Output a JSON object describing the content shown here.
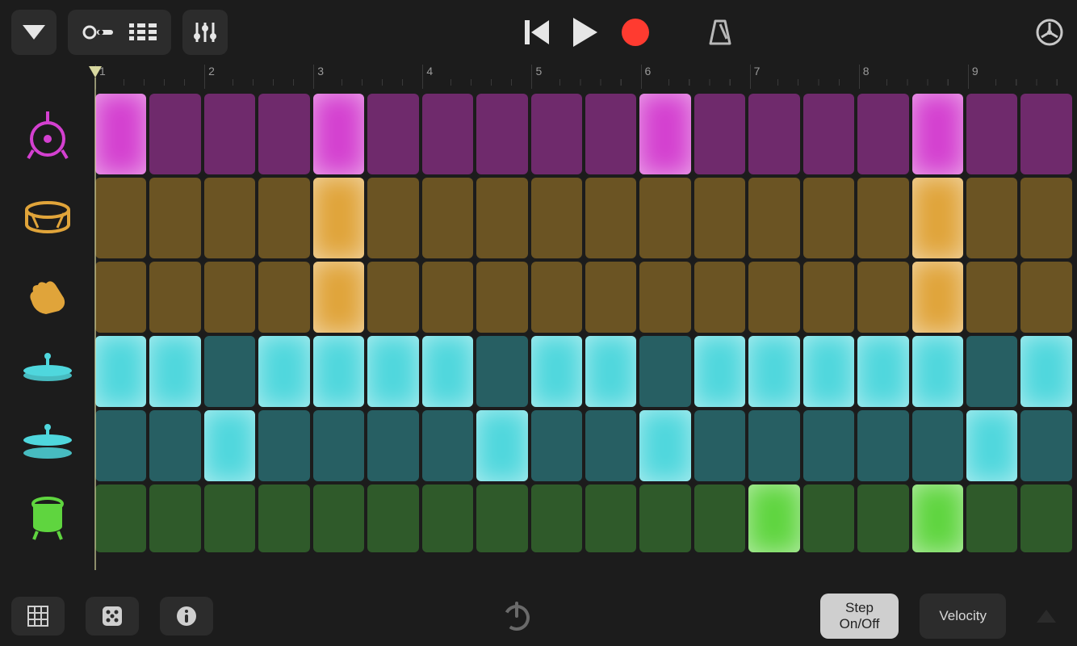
{
  "ruler": {
    "bars": [
      1,
      2,
      3,
      4,
      5,
      6,
      7,
      8,
      9
    ]
  },
  "rows": [
    {
      "id": "kick",
      "color_off": "#6f2a6c",
      "color_on": "#d440d0",
      "pattern": [
        1,
        0,
        0,
        0,
        1,
        0,
        0,
        0,
        0,
        0,
        1,
        0,
        0,
        0,
        0,
        1,
        0,
        0
      ]
    },
    {
      "id": "snare",
      "color_off": "#6b5423",
      "color_on": "#e0a43a",
      "pattern": [
        0,
        0,
        0,
        0,
        1,
        0,
        0,
        0,
        0,
        0,
        0,
        0,
        0,
        0,
        0,
        1,
        0,
        0
      ]
    },
    {
      "id": "clap",
      "color_off": "#6b5423",
      "color_on": "#e0a43a",
      "pattern": [
        0,
        0,
        0,
        0,
        1,
        0,
        0,
        0,
        0,
        0,
        0,
        0,
        0,
        0,
        0,
        1,
        0,
        0
      ]
    },
    {
      "id": "closed-hat",
      "color_off": "#275f63",
      "color_on": "#4fd7dd",
      "pattern": [
        1,
        1,
        0,
        1,
        1,
        1,
        1,
        0,
        1,
        1,
        0,
        1,
        1,
        1,
        1,
        1,
        0,
        1
      ]
    },
    {
      "id": "open-hat",
      "color_off": "#275f63",
      "color_on": "#4fd7dd",
      "pattern": [
        0,
        0,
        1,
        0,
        0,
        0,
        0,
        1,
        0,
        0,
        1,
        0,
        0,
        0,
        0,
        0,
        1,
        0
      ]
    },
    {
      "id": "tom",
      "color_off": "#2f5a2a",
      "color_on": "#5fd53f",
      "pattern": [
        0,
        0,
        0,
        0,
        0,
        0,
        0,
        0,
        0,
        0,
        0,
        0,
        1,
        0,
        0,
        1,
        0,
        0
      ]
    }
  ],
  "bottom": {
    "mode_selected": "Step\nOn/Off",
    "mode_velocity": "Velocity"
  },
  "icon_colors": {
    "kick": "#d440d0",
    "snare": "#e0a43a",
    "clap": "#e0a43a",
    "closed-hat": "#4fd7dd",
    "open-hat": "#4fd7dd",
    "tom": "#5fd53f"
  }
}
